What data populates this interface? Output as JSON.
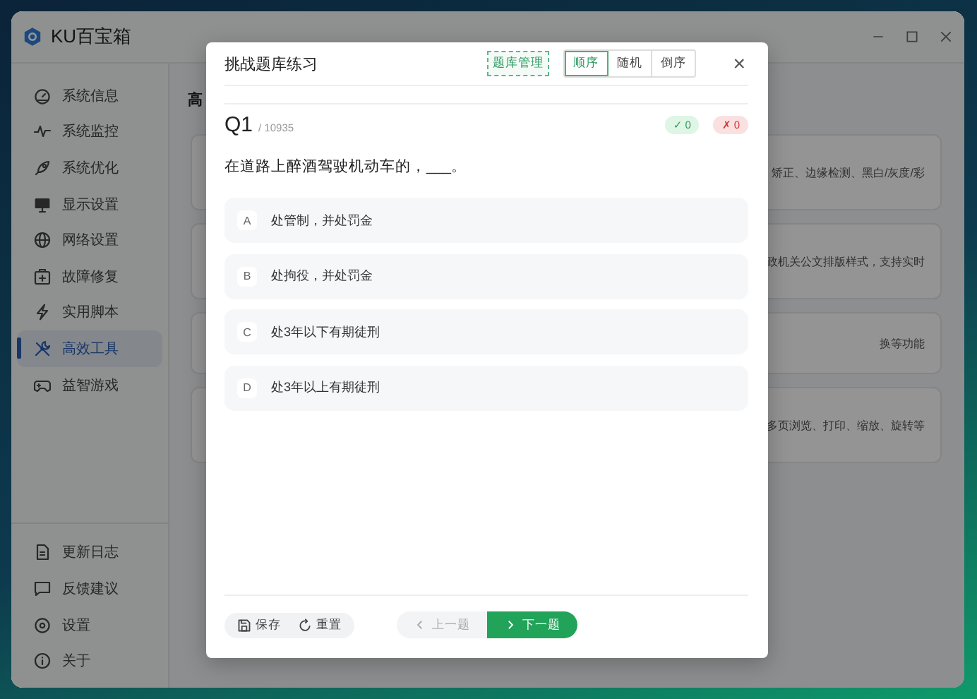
{
  "app": {
    "title": "KU百宝箱"
  },
  "sidebar": {
    "items": [
      {
        "label": "系统信息",
        "selected": false
      },
      {
        "label": "系统监控",
        "selected": false
      },
      {
        "label": "系统优化",
        "selected": false
      },
      {
        "label": "显示设置",
        "selected": false
      },
      {
        "label": "网络设置",
        "selected": false
      },
      {
        "label": "故障修复",
        "selected": false
      },
      {
        "label": "实用脚本",
        "selected": false
      },
      {
        "label": "高效工具",
        "selected": true
      },
      {
        "label": "益智游戏",
        "selected": false
      }
    ],
    "bottom_items": [
      {
        "label": "更新日志"
      },
      {
        "label": "反馈建议"
      },
      {
        "label": "设置"
      },
      {
        "label": "关于"
      }
    ]
  },
  "content": {
    "heading": "高",
    "cards": [
      {
        "description": "矫正、边缘检测、黑白/灰度/彩"
      },
      {
        "description": "政机关公文排版样式，支持实时"
      },
      {
        "description": "换等功能"
      },
      {
        "description": "多页浏览、打印、缩放、旋转等"
      }
    ]
  },
  "dialog": {
    "title": "挑战题库练习",
    "manage_button": "题库管理",
    "modes": [
      {
        "label": "顺序",
        "selected": true
      },
      {
        "label": "随机",
        "selected": false
      },
      {
        "label": "倒序",
        "selected": false
      }
    ],
    "close": "×",
    "question_number": "Q1",
    "total": "/ 10935",
    "correct": "✓ 0",
    "wrong": "✗ 0",
    "question": "在道路上醉酒驾驶机动车的，___。",
    "options": [
      {
        "letter": "A",
        "text": "处管制，并处罚金",
        "selected": false
      },
      {
        "letter": "B",
        "text": "处拘役，并处罚金",
        "selected": false
      },
      {
        "letter": "C",
        "text": "处3年以下有期徒刑",
        "selected": false
      },
      {
        "letter": "D",
        "text": "处3年以上有期徒刑",
        "selected": false
      }
    ],
    "save": "保存",
    "reset": "重置",
    "prev": {
      "label": "上一题",
      "disabled": true
    },
    "next": {
      "label": "下一题",
      "disabled": false
    }
  }
}
